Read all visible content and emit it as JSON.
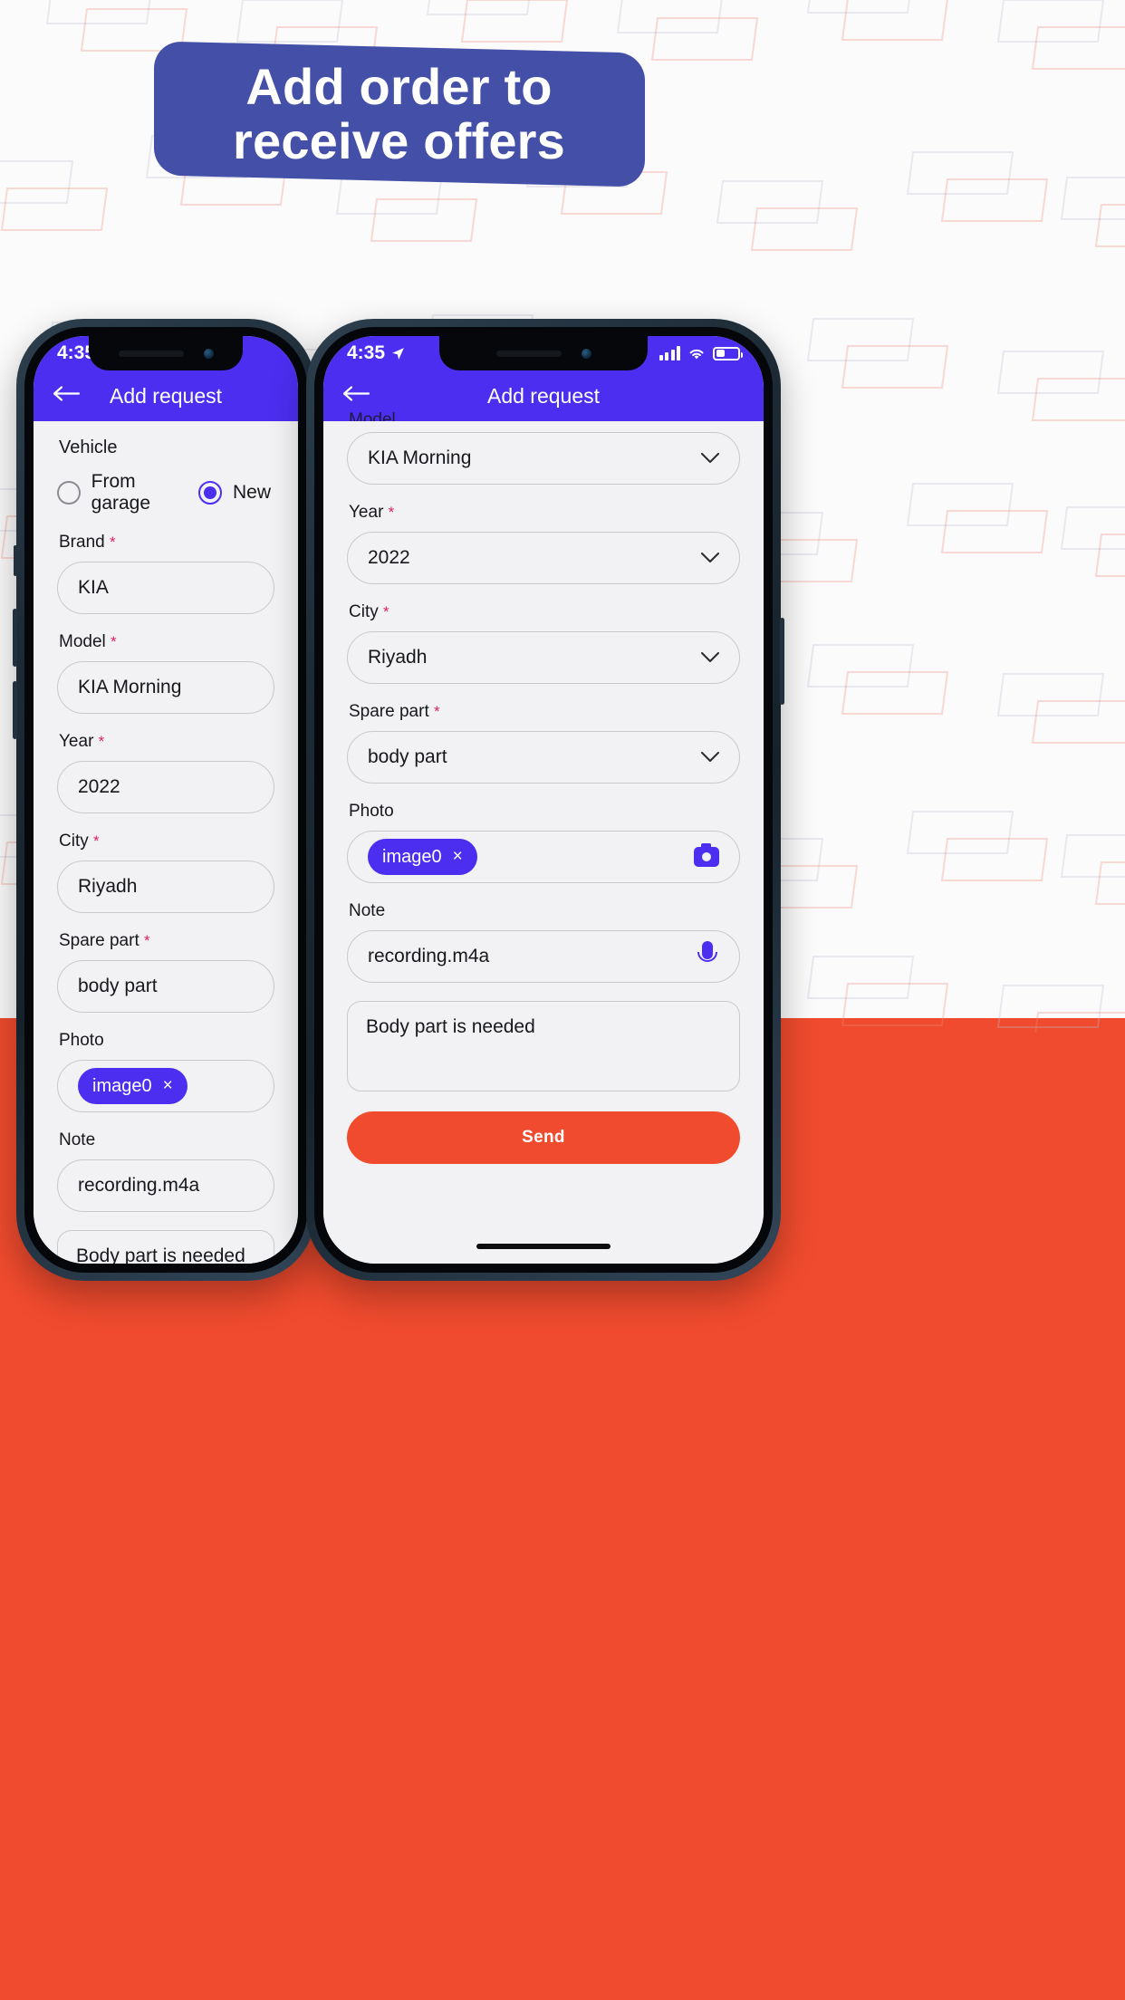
{
  "hero": {
    "banner_text": "Add order to\nreceive offers",
    "banner_color": "#4450a8"
  },
  "colors": {
    "background_top": "#fcfbfb",
    "background_bottom": "#f04b2e",
    "app_primary": "#4b2ef0",
    "accent_orange": "#f04b2e",
    "required_red": "#e0215e"
  },
  "status_bar": {
    "time": "4:35",
    "location_icon": "location-arrow-icon",
    "signal_icon": "cellular-signal-icon",
    "wifi_icon": "wifi-icon",
    "battery_icon": "battery-icon"
  },
  "nav": {
    "back_icon": "back-arrow-icon",
    "title": "Add request"
  },
  "screen_left": {
    "section_label": "Vehicle",
    "radio_options": [
      {
        "label": "From garage",
        "selected": false
      },
      {
        "label": "New",
        "selected": true
      }
    ],
    "fields": [
      {
        "label": "Brand",
        "required": true,
        "value": "KIA"
      },
      {
        "label": "Model",
        "required": true,
        "value": "KIA Morning"
      },
      {
        "label": "Year",
        "required": true,
        "value": "2022"
      },
      {
        "label": "City",
        "required": true,
        "value": "Riyadh"
      },
      {
        "label": "Spare part",
        "required": true,
        "value": "body part"
      }
    ],
    "photo": {
      "label": "Photo",
      "chip_label": "image0",
      "chip_remove": "×",
      "camera_icon": "camera-icon"
    },
    "note": {
      "label": "Note",
      "recording_value": "recording.m4a",
      "mic_icon": "microphone-icon"
    },
    "note_text": "Body part is needed"
  },
  "screen_right": {
    "partial_label_top": "Model",
    "fields": [
      {
        "label": "",
        "required": false,
        "value": "KIA Morning"
      },
      {
        "label": "Year",
        "required": true,
        "value": "2022"
      },
      {
        "label": "City",
        "required": true,
        "value": "Riyadh"
      },
      {
        "label": "Spare part",
        "required": true,
        "value": "body part"
      }
    ],
    "photo": {
      "label": "Photo",
      "chip_label": "image0",
      "chip_remove": "×",
      "camera_icon": "camera-icon"
    },
    "note": {
      "label": "Note",
      "recording_value": "recording.m4a",
      "mic_icon": "microphone-icon"
    },
    "note_text": "Body part is needed",
    "send_label": "Send"
  }
}
